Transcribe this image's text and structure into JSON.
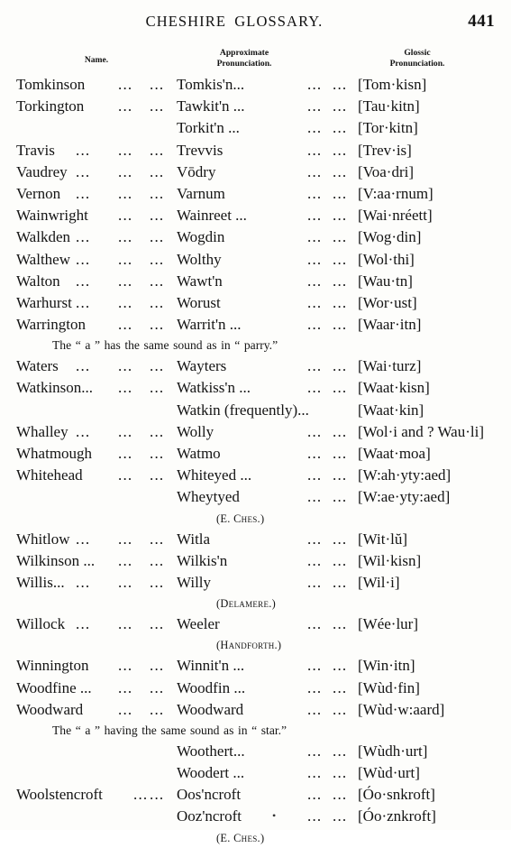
{
  "header": {
    "title": "CHESHIRE GLOSSARY.",
    "folio": "441"
  },
  "columns": {
    "name": "Name.",
    "approximate": "Approximate\nPronunciation.",
    "approximate_line1": "Approximate",
    "approximate_line2": "Pronunciation.",
    "glossic_line1": "Glossic",
    "glossic_line2": "Pronunciation."
  },
  "leader": "...",
  "rows": [
    {
      "kind": "entry",
      "name": "Tomkinson",
      "approx": "Tomkis'n...",
      "glossic": "[Tom·kisn]",
      "leaders": [
        "a",
        "b",
        "c",
        "d"
      ]
    },
    {
      "kind": "entry",
      "name": "Torkington",
      "approx": "Tawkit'n ...",
      "glossic": "[Tau·kitn]",
      "leaders": [
        "a",
        "b",
        "c",
        "d"
      ]
    },
    {
      "kind": "entry",
      "name": "",
      "approx": "Torkit'n  ...",
      "glossic": "[Tor·kitn]",
      "leaders": [
        "c",
        "d"
      ]
    },
    {
      "kind": "entry",
      "name": "Travis",
      "approx": "Trevvis",
      "glossic": "[Trev·is]",
      "leaders": [
        "n1",
        "a",
        "b",
        "c",
        "d"
      ]
    },
    {
      "kind": "entry",
      "name": "Vaudrey",
      "approx": "Vōdry",
      "glossic": "[Voa·dri]",
      "leaders": [
        "n1",
        "a",
        "b",
        "c",
        "d"
      ]
    },
    {
      "kind": "entry",
      "name": "Vernon",
      "approx": "Varnum",
      "glossic": "[V:aa·rnum]",
      "leaders": [
        "n1",
        "a",
        "b",
        "c",
        "d"
      ]
    },
    {
      "kind": "entry",
      "name": "Wainwright",
      "approx": "Wainreet ...",
      "glossic": "[Wai·nréett]",
      "leaders": [
        "a",
        "b",
        "c",
        "d"
      ]
    },
    {
      "kind": "entry",
      "name": "Walkden",
      "approx": "Wogdin",
      "glossic": "[Wog·din]",
      "leaders": [
        "n1",
        "a",
        "b",
        "c",
        "d"
      ]
    },
    {
      "kind": "entry",
      "name": "Walthew",
      "approx": "Wolthy",
      "glossic": "[Wol·thi]",
      "leaders": [
        "n1",
        "a",
        "b",
        "c",
        "d"
      ]
    },
    {
      "kind": "entry",
      "name": "Walton",
      "approx": "Wawt'n",
      "glossic": "[Wau·tn]",
      "leaders": [
        "n1",
        "a",
        "b",
        "c",
        "d"
      ]
    },
    {
      "kind": "entry",
      "name": "Warhurst",
      "approx": "Worust",
      "glossic": "[Wor·ust]",
      "leaders": [
        "n1",
        "a",
        "b",
        "c",
        "d"
      ]
    },
    {
      "kind": "entry",
      "name": "Warrington",
      "approx": "Warrit'n ...",
      "glossic": "[Waar·itn]",
      "leaders": [
        "a",
        "b",
        "c",
        "d"
      ]
    },
    {
      "kind": "note",
      "text": "The “ a ” has the same sound as in “ parry.”"
    },
    {
      "kind": "entry",
      "name": "Waters",
      "approx": "Wayters",
      "glossic": "[Wai·turz]",
      "leaders": [
        "n1",
        "a",
        "b",
        "c",
        "d"
      ]
    },
    {
      "kind": "entry",
      "name": "Watkinson...",
      "approx": "Watkiss'n ...",
      "glossic": "[Waat·kisn]",
      "leaders": [
        "a",
        "b",
        "c",
        "d"
      ]
    },
    {
      "kind": "entry",
      "name": "",
      "approx": "Watkin (frequently)...",
      "glossic": "[Waat·kin]",
      "leaders": []
    },
    {
      "kind": "entry",
      "name": "Whalley",
      "approx": "Wolly",
      "glossic": "[Wol·i and ? Wau·li]",
      "leaders": [
        "n1",
        "a",
        "b",
        "c",
        "d"
      ]
    },
    {
      "kind": "entry",
      "name": "Whatmough",
      "approx": "Watmo",
      "glossic": "[Waat·moa]",
      "leaders": [
        "a",
        "b",
        "c",
        "d"
      ]
    },
    {
      "kind": "entry",
      "name": "Whitehead",
      "approx": "Whiteyed ...",
      "glossic": "[W:ah·yty:aed]",
      "leaders": [
        "a",
        "b",
        "c",
        "d"
      ]
    },
    {
      "kind": "entry",
      "name": "",
      "approx": "Wheytyed",
      "glossic": "[W:ae·yty:aed]",
      "leaders": [
        "c",
        "d"
      ]
    },
    {
      "kind": "locality",
      "text": "(E. Ches.)"
    },
    {
      "kind": "entry",
      "name": "Whitlow",
      "approx": "Witla",
      "glossic": "[Wit·lŭ]",
      "leaders": [
        "n1",
        "a",
        "b",
        "c",
        "d"
      ]
    },
    {
      "kind": "entry",
      "name": "Wilkinson ...",
      "approx": "Wilkis'n",
      "glossic": "[Wil·kisn]",
      "leaders": [
        "a",
        "b",
        "c",
        "d"
      ]
    },
    {
      "kind": "entry",
      "name": "Willis...",
      "approx": "Willy",
      "glossic": "[Wil·i]",
      "leaders": [
        "n1",
        "a",
        "b",
        "c",
        "d"
      ]
    },
    {
      "kind": "locality",
      "text": "(Delamere.)"
    },
    {
      "kind": "entry",
      "name": "Willock",
      "approx": "Weeler",
      "glossic": "[Wée·lur]",
      "leaders": [
        "n1",
        "a",
        "b",
        "c",
        "d"
      ]
    },
    {
      "kind": "locality",
      "text": "(Handforth.)"
    },
    {
      "kind": "entry",
      "name": "Winnington",
      "approx": "Winnit'n ...",
      "glossic": "[Win·itn]",
      "leaders": [
        "a",
        "b",
        "c",
        "d"
      ]
    },
    {
      "kind": "entry",
      "name": "Woodfine ...",
      "approx": "Woodfin ...",
      "glossic": "[Wùd·fin]",
      "leaders": [
        "a",
        "b",
        "c",
        "d"
      ]
    },
    {
      "kind": "entry",
      "name": "Woodward",
      "approx": "Woodward",
      "glossic": "[Wùd·w:aard]",
      "leaders": [
        "a",
        "b",
        "c",
        "d"
      ]
    },
    {
      "kind": "note",
      "text": "The “ a ” having the same sound as in “ star.”"
    },
    {
      "kind": "entry",
      "name": "",
      "approx": "Woothert...",
      "glossic": "[Wùdh·urt]",
      "leaders": [
        "c",
        "d"
      ]
    },
    {
      "kind": "entry",
      "name": "",
      "approx": "Woodert ...",
      "glossic": "[Wùd·urt]",
      "leaders": [
        "c",
        "d"
      ]
    },
    {
      "kind": "entry",
      "name": "Woolstencroft",
      "approx": "Oos'ncroft",
      "glossic": "[Óo·snkroft]",
      "leaders": [
        "a2",
        "b",
        "c",
        "d"
      ]
    },
    {
      "kind": "entry",
      "name": "",
      "approx": "Ooz'ncroft",
      "glossic": "[Óo·znkroft]",
      "leaders": [
        "c",
        "d"
      ],
      "stray_dot": true
    },
    {
      "kind": "locality",
      "text": "(E. Ches.)"
    }
  ]
}
